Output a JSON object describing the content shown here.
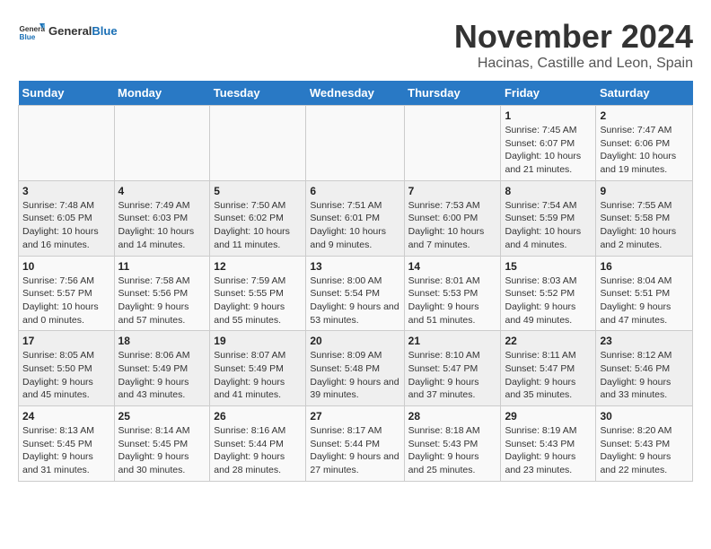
{
  "header": {
    "logo_general": "General",
    "logo_blue": "Blue",
    "title": "November 2024",
    "subtitle": "Hacinas, Castille and Leon, Spain"
  },
  "weekdays": [
    "Sunday",
    "Monday",
    "Tuesday",
    "Wednesday",
    "Thursday",
    "Friday",
    "Saturday"
  ],
  "weeks": [
    [
      {
        "day": "",
        "info": ""
      },
      {
        "day": "",
        "info": ""
      },
      {
        "day": "",
        "info": ""
      },
      {
        "day": "",
        "info": ""
      },
      {
        "day": "",
        "info": ""
      },
      {
        "day": "1",
        "info": "Sunrise: 7:45 AM\nSunset: 6:07 PM\nDaylight: 10 hours and 21 minutes."
      },
      {
        "day": "2",
        "info": "Sunrise: 7:47 AM\nSunset: 6:06 PM\nDaylight: 10 hours and 19 minutes."
      }
    ],
    [
      {
        "day": "3",
        "info": "Sunrise: 7:48 AM\nSunset: 6:05 PM\nDaylight: 10 hours and 16 minutes."
      },
      {
        "day": "4",
        "info": "Sunrise: 7:49 AM\nSunset: 6:03 PM\nDaylight: 10 hours and 14 minutes."
      },
      {
        "day": "5",
        "info": "Sunrise: 7:50 AM\nSunset: 6:02 PM\nDaylight: 10 hours and 11 minutes."
      },
      {
        "day": "6",
        "info": "Sunrise: 7:51 AM\nSunset: 6:01 PM\nDaylight: 10 hours and 9 minutes."
      },
      {
        "day": "7",
        "info": "Sunrise: 7:53 AM\nSunset: 6:00 PM\nDaylight: 10 hours and 7 minutes."
      },
      {
        "day": "8",
        "info": "Sunrise: 7:54 AM\nSunset: 5:59 PM\nDaylight: 10 hours and 4 minutes."
      },
      {
        "day": "9",
        "info": "Sunrise: 7:55 AM\nSunset: 5:58 PM\nDaylight: 10 hours and 2 minutes."
      }
    ],
    [
      {
        "day": "10",
        "info": "Sunrise: 7:56 AM\nSunset: 5:57 PM\nDaylight: 10 hours and 0 minutes."
      },
      {
        "day": "11",
        "info": "Sunrise: 7:58 AM\nSunset: 5:56 PM\nDaylight: 9 hours and 57 minutes."
      },
      {
        "day": "12",
        "info": "Sunrise: 7:59 AM\nSunset: 5:55 PM\nDaylight: 9 hours and 55 minutes."
      },
      {
        "day": "13",
        "info": "Sunrise: 8:00 AM\nSunset: 5:54 PM\nDaylight: 9 hours and 53 minutes."
      },
      {
        "day": "14",
        "info": "Sunrise: 8:01 AM\nSunset: 5:53 PM\nDaylight: 9 hours and 51 minutes."
      },
      {
        "day": "15",
        "info": "Sunrise: 8:03 AM\nSunset: 5:52 PM\nDaylight: 9 hours and 49 minutes."
      },
      {
        "day": "16",
        "info": "Sunrise: 8:04 AM\nSunset: 5:51 PM\nDaylight: 9 hours and 47 minutes."
      }
    ],
    [
      {
        "day": "17",
        "info": "Sunrise: 8:05 AM\nSunset: 5:50 PM\nDaylight: 9 hours and 45 minutes."
      },
      {
        "day": "18",
        "info": "Sunrise: 8:06 AM\nSunset: 5:49 PM\nDaylight: 9 hours and 43 minutes."
      },
      {
        "day": "19",
        "info": "Sunrise: 8:07 AM\nSunset: 5:49 PM\nDaylight: 9 hours and 41 minutes."
      },
      {
        "day": "20",
        "info": "Sunrise: 8:09 AM\nSunset: 5:48 PM\nDaylight: 9 hours and 39 minutes."
      },
      {
        "day": "21",
        "info": "Sunrise: 8:10 AM\nSunset: 5:47 PM\nDaylight: 9 hours and 37 minutes."
      },
      {
        "day": "22",
        "info": "Sunrise: 8:11 AM\nSunset: 5:47 PM\nDaylight: 9 hours and 35 minutes."
      },
      {
        "day": "23",
        "info": "Sunrise: 8:12 AM\nSunset: 5:46 PM\nDaylight: 9 hours and 33 minutes."
      }
    ],
    [
      {
        "day": "24",
        "info": "Sunrise: 8:13 AM\nSunset: 5:45 PM\nDaylight: 9 hours and 31 minutes."
      },
      {
        "day": "25",
        "info": "Sunrise: 8:14 AM\nSunset: 5:45 PM\nDaylight: 9 hours and 30 minutes."
      },
      {
        "day": "26",
        "info": "Sunrise: 8:16 AM\nSunset: 5:44 PM\nDaylight: 9 hours and 28 minutes."
      },
      {
        "day": "27",
        "info": "Sunrise: 8:17 AM\nSunset: 5:44 PM\nDaylight: 9 hours and 27 minutes."
      },
      {
        "day": "28",
        "info": "Sunrise: 8:18 AM\nSunset: 5:43 PM\nDaylight: 9 hours and 25 minutes."
      },
      {
        "day": "29",
        "info": "Sunrise: 8:19 AM\nSunset: 5:43 PM\nDaylight: 9 hours and 23 minutes."
      },
      {
        "day": "30",
        "info": "Sunrise: 8:20 AM\nSunset: 5:43 PM\nDaylight: 9 hours and 22 minutes."
      }
    ]
  ]
}
